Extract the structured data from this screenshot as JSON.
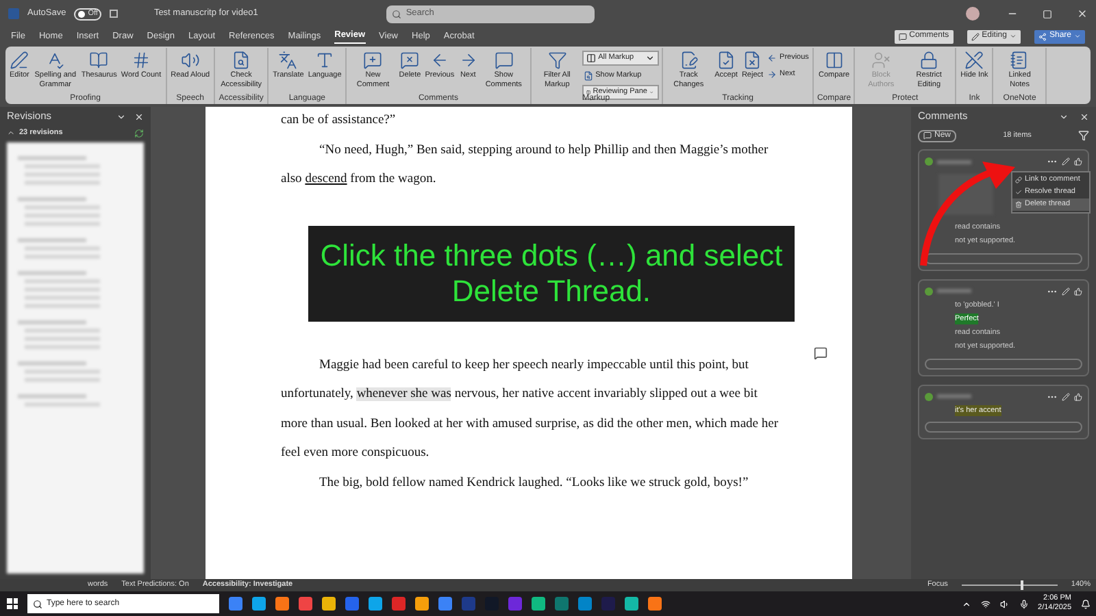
{
  "title_bar": {
    "autosave_label": "AutoSave",
    "autosave": {
      "on": false,
      "label": "Off"
    },
    "document_title": "Test manuscritp for video1",
    "search_placeholder": "Search"
  },
  "menu_tabs": [
    {
      "label": "File",
      "selected": false
    },
    {
      "label": "Home",
      "selected": false
    },
    {
      "label": "Insert",
      "selected": false
    },
    {
      "label": "Draw",
      "selected": false
    },
    {
      "label": "Design",
      "selected": false
    },
    {
      "label": "Layout",
      "selected": false
    },
    {
      "label": "References",
      "selected": false
    },
    {
      "label": "Mailings",
      "selected": false
    },
    {
      "label": "Review",
      "selected": true
    },
    {
      "label": "View",
      "selected": false
    },
    {
      "label": "Help",
      "selected": false
    },
    {
      "label": "Acrobat",
      "selected": false
    }
  ],
  "header_buttons": [
    {
      "label": "Comments",
      "kind": "plain"
    },
    {
      "label": "Editing",
      "kind": "dropdown"
    },
    {
      "label": "Share",
      "kind": "primary"
    }
  ],
  "ribbon_groups": [
    {
      "label": "Proofing",
      "buttons": [
        {
          "label": "Editor",
          "kind": "large",
          "disabled": false
        },
        {
          "label": "Spelling and Grammar",
          "kind": "large",
          "disabled": false
        },
        {
          "label": "Thesaurus",
          "kind": "large",
          "disabled": false
        },
        {
          "label": "Word Count",
          "kind": "large",
          "disabled": false
        }
      ]
    },
    {
      "label": "Speech",
      "buttons": [
        {
          "label": "Read Aloud",
          "kind": "large",
          "disabled": false
        }
      ]
    },
    {
      "label": "Accessibility",
      "buttons": [
        {
          "label": "Check Accessibility",
          "kind": "large",
          "disabled": false
        }
      ]
    },
    {
      "label": "Language",
      "buttons": [
        {
          "label": "Translate",
          "kind": "large",
          "disabled": false
        },
        {
          "label": "Language",
          "kind": "large",
          "disabled": false
        }
      ]
    },
    {
      "label": "Comments",
      "buttons": [
        {
          "label": "New Comment",
          "kind": "large",
          "disabled": false
        },
        {
          "label": "Delete",
          "kind": "large",
          "disabled": false
        },
        {
          "label": "Previous",
          "kind": "large",
          "disabled": false
        },
        {
          "label": "Next",
          "kind": "large",
          "disabled": false
        },
        {
          "label": "Show Comments",
          "kind": "large",
          "disabled": false
        }
      ]
    },
    {
      "label": "Markup",
      "buttons": [
        {
          "label": "Filter All Markup",
          "kind": "large",
          "disabled": false
        },
        {
          "label": "All Markup",
          "kind": "select",
          "disabled": false
        },
        {
          "label": "Show Markup",
          "kind": "small",
          "disabled": false
        },
        {
          "label": "Reviewing Pane",
          "kind": "select",
          "disabled": false
        }
      ]
    },
    {
      "label": "Tracking",
      "buttons": [
        {
          "label": "Track Changes",
          "kind": "large",
          "disabled": false
        },
        {
          "label": "Accept",
          "kind": "large",
          "disabled": false
        },
        {
          "label": "Reject",
          "kind": "large",
          "disabled": false
        },
        {
          "label": "Previous",
          "kind": "small",
          "disabled": false
        },
        {
          "label": "Next",
          "kind": "small",
          "disabled": false
        }
      ]
    },
    {
      "label": "Compare",
      "buttons": [
        {
          "label": "Compare",
          "kind": "large",
          "disabled": false
        }
      ]
    },
    {
      "label": "Protect",
      "buttons": [
        {
          "label": "Block Authors",
          "kind": "large",
          "disabled": true
        },
        {
          "label": "Restrict Editing",
          "kind": "large",
          "disabled": false
        }
      ]
    },
    {
      "label": "Ink",
      "buttons": [
        {
          "label": "Hide Ink",
          "kind": "large",
          "disabled": false
        }
      ]
    },
    {
      "label": "OneNote",
      "buttons": [
        {
          "label": "Linked Notes",
          "kind": "large",
          "disabled": false
        }
      ]
    }
  ],
  "revisions_pane": {
    "title": "Revisions",
    "count": "23 revisions"
  },
  "document": {
    "paragraphs": [
      {
        "text": "can be of assistance?”",
        "indent": false
      },
      {
        "text": "“No need, Hugh,” Ben said, stepping around to help Phillip and then Maggie’s mother also **descend** from the wagon.",
        "indent": true
      }
    ],
    "overlay": "Click the three dots (…) and select Delete Thread.",
    "paragraphs_after": [
      {
        "text": "Maggie had been careful to keep her speech nearly impeccable until this point, but unfortunately, *whenever she was* nervous, her native accent invariably slipped out a wee bit more than usual. Ben looked at her with amused surprise, as did the other men, which made her feel even more conspicuous.",
        "indent": true
      },
      {
        "text": "The big, bold fellow named Kendrick laughed. “Looks like we struck gold, boys!”",
        "indent": true
      }
    ]
  },
  "comments_pane": {
    "title": "Comments",
    "new_button": "New",
    "count": "18 items",
    "menu": [
      {
        "label": "Link to comment",
        "selected": false
      },
      {
        "label": "Resolve thread",
        "selected": false
      },
      {
        "label": "Delete thread",
        "selected": true
      }
    ],
    "cards": [
      {
        "lines": [
          {
            "text": "read contains",
            "kind": "plain"
          },
          {
            "text": "not yet supported.",
            "kind": "plain"
          }
        ]
      },
      {
        "lines": [
          {
            "text": "to 'gobbled.' I",
            "kind": "plain"
          },
          {
            "text": "Perfect",
            "kind": "success"
          },
          {
            "text": "read contains",
            "kind": "plain"
          },
          {
            "text": "not yet supported.",
            "kind": "plain"
          }
        ]
      },
      {
        "lines": [
          {
            "text": "it's her accent",
            "kind": "highlight"
          }
        ]
      }
    ]
  },
  "status_bar": {
    "words": "words",
    "text_predictions": "Text Predictions: On",
    "accessibility": "Accessibility: Investigate",
    "focus": "Focus",
    "zoom": "140%",
    "zoom_level": {
      "level": 0.62
    }
  },
  "taskbar": {
    "search_placeholder": "Type here to search",
    "time": "2:06 PM",
    "date": "2/14/2025"
  }
}
